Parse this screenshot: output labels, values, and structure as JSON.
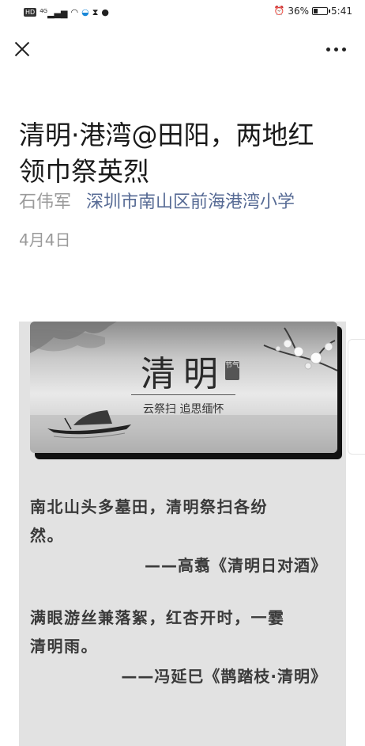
{
  "status_bar": {
    "left_icons": [
      "hd-icon",
      "signal-icon",
      "wifi-icon",
      "app-icon",
      "hourglass-icon",
      "chat-icon"
    ],
    "hd_label": "HD",
    "network_label": "4G",
    "alarm_icon": "alarm-icon",
    "battery_percent": "36%",
    "battery_level": 0.36,
    "time": "5:41"
  },
  "nav": {
    "close_icon": "close-icon",
    "more_icon": "more-icon"
  },
  "article": {
    "title": "清明·港湾@田阳，两地红领巾祭英烈",
    "author": "石伟军",
    "account": "深圳市南山区前海港湾小学",
    "date": "4月4日"
  },
  "banner": {
    "title": "清明",
    "seal": "节气",
    "subtitle": "云祭扫 追思缅怀"
  },
  "poems": [
    {
      "lines": [
        "南北山头多墓田，清明祭扫各纷",
        "然。"
      ],
      "source": "——高翥《清明日对酒》"
    },
    {
      "lines": [
        "满眼游丝兼落絮，红杏开时，一霎",
        "清明雨。"
      ],
      "source": "——冯延巳《鹊踏枝·清明》"
    }
  ]
}
